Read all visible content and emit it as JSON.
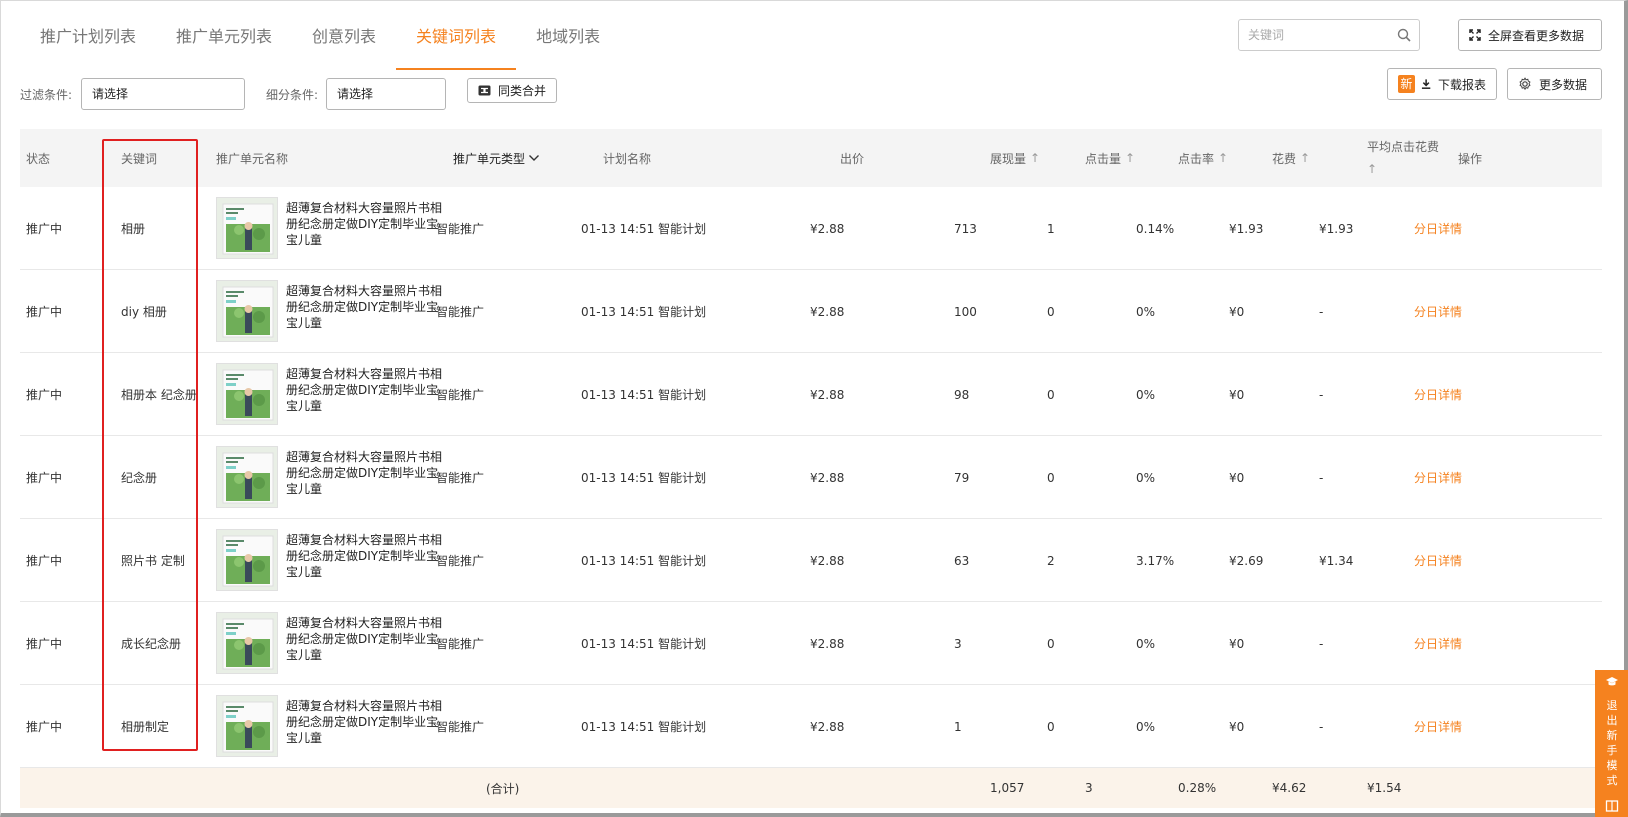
{
  "tabs": [
    {
      "label": "推广计划列表",
      "active": false
    },
    {
      "label": "推广单元列表",
      "active": false
    },
    {
      "label": "创意列表",
      "active": false
    },
    {
      "label": "关键词列表",
      "active": true
    },
    {
      "label": "地域列表",
      "active": false
    }
  ],
  "search": {
    "placeholder": "关键词"
  },
  "toolbar": {
    "fullscreen_label": "全屏查看更多数据",
    "new_badge": "新",
    "download_label": "下载报表",
    "more_data_label": "更多数据"
  },
  "filters": {
    "filter_label": "过滤条件:",
    "filter_value": "请选择",
    "sub_label": "细分条件:",
    "sub_value": "请选择",
    "merge_label": "同类合并"
  },
  "columns": {
    "status": "状态",
    "keyword": "关键词",
    "unit_name": "推广单元名称",
    "unit_type": "推广单元类型",
    "plan_name": "计划名称",
    "bid": "出价",
    "impressions": "展现量",
    "clicks": "点击量",
    "ctr": "点击率",
    "cost": "花费",
    "avg_cpc": "平均点击花费",
    "action": "操作"
  },
  "rows": [
    {
      "status": "推广中",
      "keyword": "相册",
      "unit_name": "超薄复合材料大容量照片书相册纪念册定做DIY定制毕业宝宝儿童",
      "unit_type": "智能推广",
      "plan_name": "01-13 14:51 智能计划",
      "bid": "¥2.88",
      "impressions": "713",
      "clicks": "1",
      "ctr": "0.14%",
      "cost": "¥1.93",
      "avg_cpc": "¥1.93",
      "action": "分日详情"
    },
    {
      "status": "推广中",
      "keyword": "diy 相册",
      "unit_name": "超薄复合材料大容量照片书相册纪念册定做DIY定制毕业宝宝儿童",
      "unit_type": "智能推广",
      "plan_name": "01-13 14:51 智能计划",
      "bid": "¥2.88",
      "impressions": "100",
      "clicks": "0",
      "ctr": "0%",
      "cost": "¥0",
      "avg_cpc": "-",
      "action": "分日详情"
    },
    {
      "status": "推广中",
      "keyword": "相册本 纪念册",
      "unit_name": "超薄复合材料大容量照片书相册纪念册定做DIY定制毕业宝宝儿童",
      "unit_type": "智能推广",
      "plan_name": "01-13 14:51 智能计划",
      "bid": "¥2.88",
      "impressions": "98",
      "clicks": "0",
      "ctr": "0%",
      "cost": "¥0",
      "avg_cpc": "-",
      "action": "分日详情"
    },
    {
      "status": "推广中",
      "keyword": "纪念册",
      "unit_name": "超薄复合材料大容量照片书相册纪念册定做DIY定制毕业宝宝儿童",
      "unit_type": "智能推广",
      "plan_name": "01-13 14:51 智能计划",
      "bid": "¥2.88",
      "impressions": "79",
      "clicks": "0",
      "ctr": "0%",
      "cost": "¥0",
      "avg_cpc": "-",
      "action": "分日详情"
    },
    {
      "status": "推广中",
      "keyword": "照片书 定制",
      "unit_name": "超薄复合材料大容量照片书相册纪念册定做DIY定制毕业宝宝儿童",
      "unit_type": "智能推广",
      "plan_name": "01-13 14:51 智能计划",
      "bid": "¥2.88",
      "impressions": "63",
      "clicks": "2",
      "ctr": "3.17%",
      "cost": "¥2.69",
      "avg_cpc": "¥1.34",
      "action": "分日详情"
    },
    {
      "status": "推广中",
      "keyword": "成长纪念册",
      "unit_name": "超薄复合材料大容量照片书相册纪念册定做DIY定制毕业宝宝儿童",
      "unit_type": "智能推广",
      "plan_name": "01-13 14:51 智能计划",
      "bid": "¥2.88",
      "impressions": "3",
      "clicks": "0",
      "ctr": "0%",
      "cost": "¥0",
      "avg_cpc": "-",
      "action": "分日详情"
    },
    {
      "status": "推广中",
      "keyword": "相册制定",
      "unit_name": "超薄复合材料大容量照片书相册纪念册定做DIY定制毕业宝宝儿童",
      "unit_type": "智能推广",
      "plan_name": "01-13 14:51 智能计划",
      "bid": "¥2.88",
      "impressions": "1",
      "clicks": "0",
      "ctr": "0%",
      "cost": "¥0",
      "avg_cpc": "-",
      "action": "分日详情"
    }
  ],
  "totals": {
    "label": "(合计)",
    "impressions": "1,057",
    "clicks": "3",
    "ctr": "0.28%",
    "cost": "¥4.62",
    "avg_cpc": "¥1.54"
  },
  "side_panel": {
    "label": "退出新手模式"
  },
  "colors": {
    "accent": "#f5821f",
    "highlight": "#e02020",
    "header_bg": "#f4f4f4",
    "footer_bg": "#fbf3ea"
  }
}
